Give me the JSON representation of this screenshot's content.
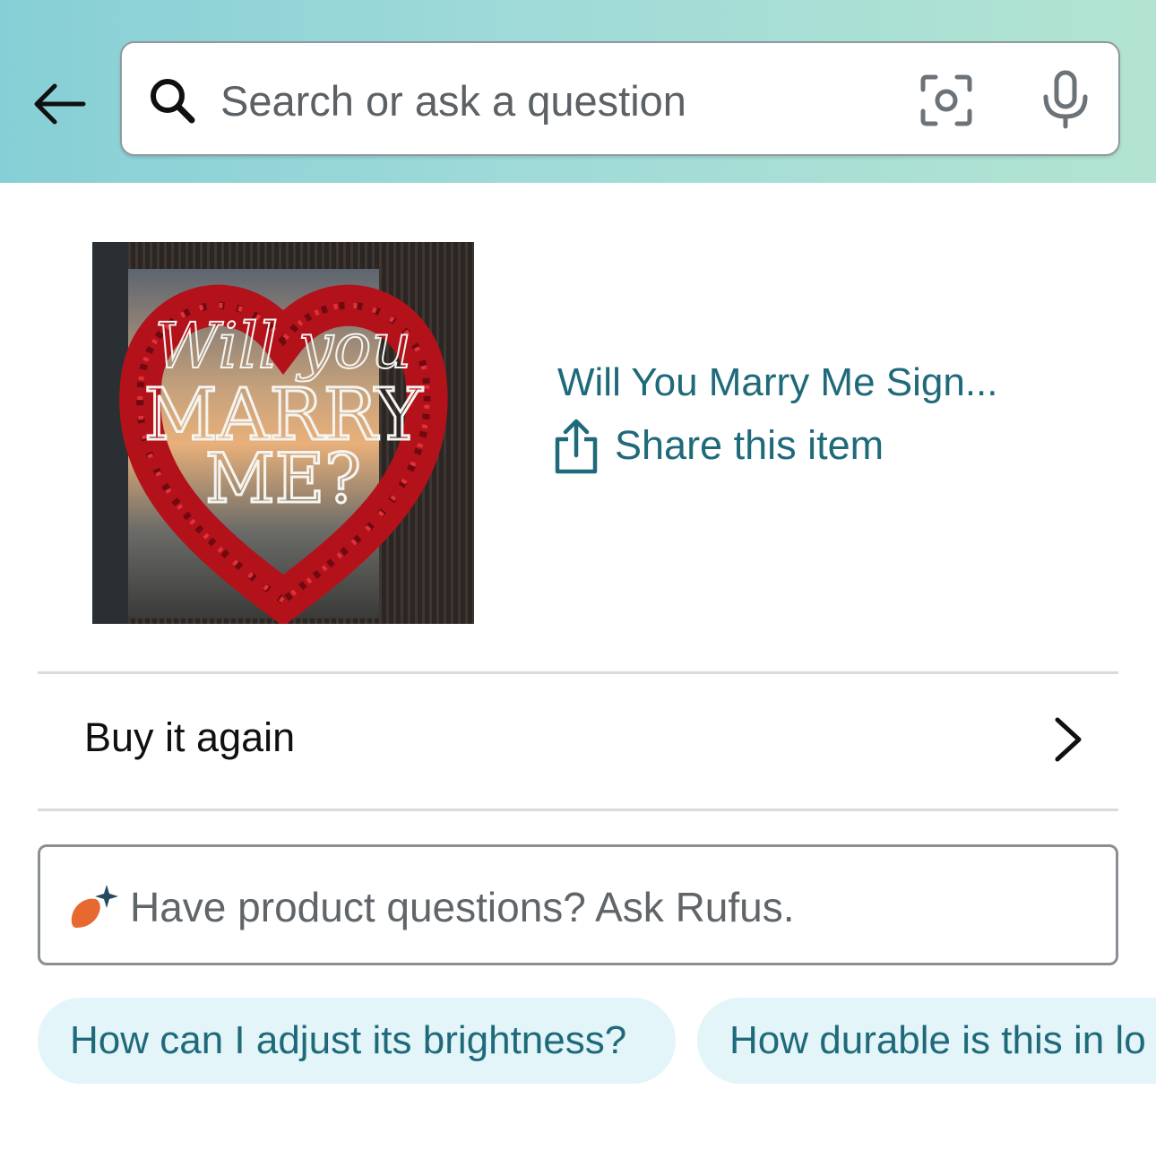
{
  "header": {
    "search": {
      "placeholder": "Search or ask a question"
    },
    "icons": [
      "back-arrow-icon",
      "search-icon",
      "camera-lens-icon",
      "microphone-icon"
    ]
  },
  "product": {
    "image_text": [
      "Will you",
      "MARRY",
      "ME?"
    ],
    "title": "Will You Marry Me Sign...",
    "share_label": "Share this item"
  },
  "buy_again": {
    "label": "Buy it again"
  },
  "rufus": {
    "placeholder": "Have product questions? Ask Rufus."
  },
  "suggestions": [
    "How can I adjust its brightness?",
    "How durable is this in lo"
  ],
  "colors": {
    "link_teal": "#1f6a7a",
    "chip_bg": "#e3f5f9",
    "header_gradient_start": "#86cfd6",
    "header_gradient_end": "#b3e4d1",
    "rufus_orange": "#e8692f",
    "rufus_spark": "#234a61"
  }
}
